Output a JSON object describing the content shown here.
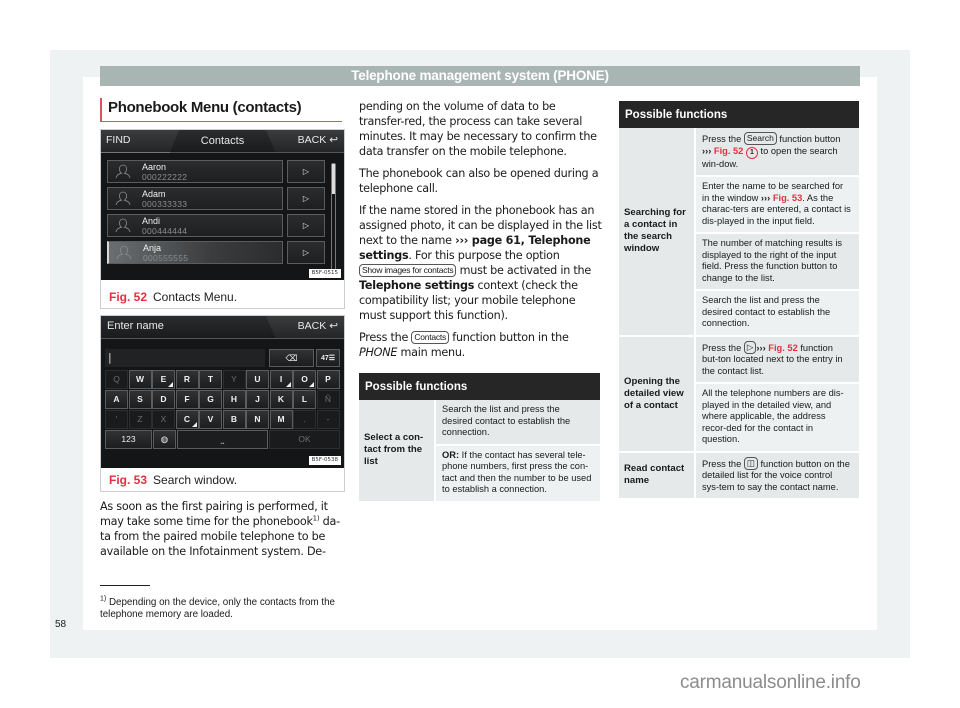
{
  "header": {
    "title": "Telephone management system (PHONE)"
  },
  "section": {
    "title": "Phonebook Menu (contacts)"
  },
  "fig52": {
    "screen": {
      "find_label": "FIND",
      "title": "Contacts",
      "back_label": "BACK",
      "contacts": [
        {
          "name": "Aaron",
          "number": "000222222",
          "selected": false
        },
        {
          "name": "Adam",
          "number": "000333333",
          "selected": false
        },
        {
          "name": "Andi",
          "number": "000444444",
          "selected": false
        },
        {
          "name": "Anja",
          "number": "000555555",
          "selected": true
        }
      ],
      "detail_button_icon": "play-triangle-icon",
      "code": "B5F-0515"
    },
    "caption_num": "Fig. 52",
    "caption_text": "Contacts Menu."
  },
  "fig53": {
    "screen": {
      "title": "Enter name",
      "back_label": "BACK",
      "input_value": "|",
      "rows": [
        [
          "Q",
          "W",
          "E",
          "R",
          "T",
          "Y",
          "U",
          "I",
          "O",
          "P"
        ],
        [
          "A",
          "S",
          "D",
          "F",
          "G",
          "H",
          "J",
          "K",
          "L",
          "Ñ"
        ],
        [
          "'",
          "Z",
          "X",
          "C",
          "V",
          "B",
          "N",
          "M",
          ".",
          "-"
        ]
      ],
      "key_123": "123",
      "key_ok": "OK",
      "key_space": "⎵",
      "code": "B5F-0538"
    },
    "caption_num": "Fig. 53",
    "caption_text": "Search window."
  },
  "col1_text": {
    "p1_a": "As soon as the first pairing is performed, it may take some time for the phonebook",
    "p1_sup": "1)",
    "p1_b": " da-ta from the paired mobile telephone to be available on the Infotainment system. De-"
  },
  "col2_text": {
    "p1": "pending on the volume of data to be transfer-red, the process can take several minutes. It may be necessary to confirm the data transfer on the mobile telephone.",
    "p2": "The phonebook can also be opened during a telephone call.",
    "p3_a": "If the name stored in the phonebook has an assigned photo, it can be displayed in the list next to the name ",
    "p3_xref": "››› page 61, Telephone settings",
    "p3_b": ". For this purpose the option ",
    "p3_btn": "Show images for contacts",
    "p3_c": " must be activated in the ",
    "p3_bold": "Telephone settings",
    "p3_d": " context (check the compatibility list; your mobile telephone must support this function).",
    "p4_a": "Press the ",
    "p4_btn": "Contacts",
    "p4_b": " function button in the ",
    "p4_italic": "PHONE",
    "p4_c": " main menu."
  },
  "table1": {
    "header": "Possible functions",
    "label": "Select a con-tact from the list",
    "rows": [
      {
        "text": "Search the list and press the desired contact to establish the connection."
      },
      {
        "bold": "OR:",
        "text": " If the contact has several tele-phone numbers, first press the con-tact and then the number to be used to establish a connection."
      }
    ]
  },
  "table2": {
    "header": "Possible functions",
    "groups": [
      {
        "label": "Searching for a contact in the search window",
        "r1_a": "Press the ",
        "r1_btn": "Search",
        "r1_b": " function button ",
        "r1_arrow": "›››",
        "r1_fig": "Fig. 52",
        "r1_circ": "1",
        "r1_c": " to open the search win-dow.",
        "r2_a": "Enter the name to be searched for in the window ",
        "r2_arrow": "›››",
        "r2_fig": "Fig. 53",
        "r2_b": ". As the charac-ters are entered, a contact is dis-played in the input field.",
        "r3": "The number of matching results is displayed to the right of the input field. Press the function button to change to the list.",
        "r4": "Search the list and press the desired contact to establish the connection."
      },
      {
        "label": "Opening the detailed view of a contact",
        "r1_a": "Press the ",
        "r1_icon": "▷",
        "r1_arrow": "›››",
        "r1_fig": "Fig. 52",
        "r1_b": " function but-ton located next to the entry in the contact list.",
        "r2": "All the telephone numbers are dis-played in the detailed view, and where applicable, the address recor-ded for the contact in question."
      },
      {
        "label": "Read contact name",
        "r1_a": "Press the ",
        "r1_icon": "◫",
        "r1_b": " function button on the detailed list for the voice control sys-tem to say the contact name."
      }
    ]
  },
  "footnote": {
    "mark": "1)",
    "text": " Depending on the device, only the contacts from the telephone memory are loaded."
  },
  "page_number": "58",
  "watermark": "carmanualsonline.info",
  "colors": {
    "accent_red": "#e0313f",
    "header_gray": "#a9b5b3",
    "table_header": "#262626"
  }
}
